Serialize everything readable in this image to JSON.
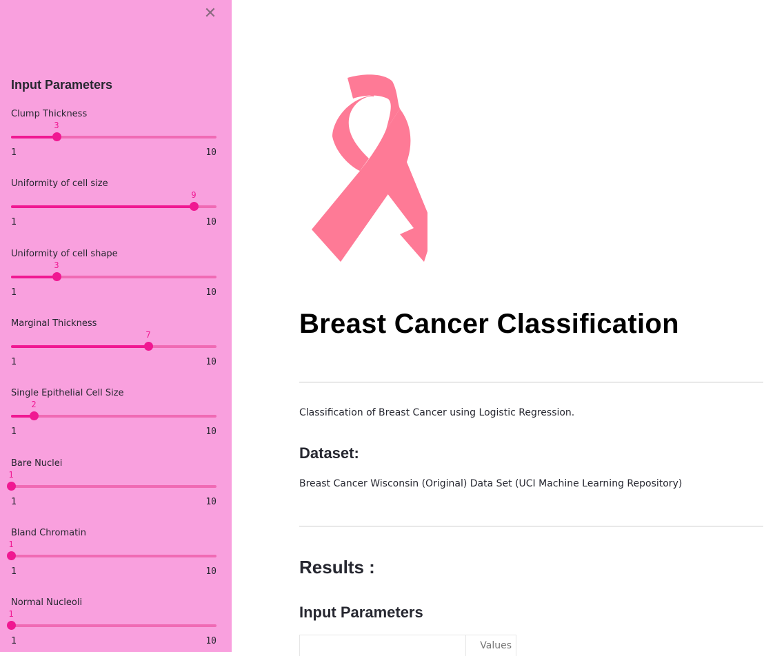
{
  "sidebar": {
    "close_icon": "close-icon",
    "heading": "Input Parameters",
    "sliders": [
      {
        "label": "Clump Thickness",
        "value": 3,
        "min": 1,
        "max": 10
      },
      {
        "label": "Uniformity of cell size",
        "value": 9,
        "min": 1,
        "max": 10
      },
      {
        "label": "Uniformity of cell shape",
        "value": 3,
        "min": 1,
        "max": 10
      },
      {
        "label": "Marginal Thickness",
        "value": 7,
        "min": 1,
        "max": 10
      },
      {
        "label": "Single Epithelial Cell Size",
        "value": 2,
        "min": 1,
        "max": 10
      },
      {
        "label": "Bare Nuclei",
        "value": 1,
        "min": 1,
        "max": 10
      },
      {
        "label": "Bland Chromatin",
        "value": 1,
        "min": 1,
        "max": 10
      },
      {
        "label": "Normal Nucleoli",
        "value": 1,
        "min": 1,
        "max": 10
      }
    ]
  },
  "main": {
    "logo_icon": "pink-ribbon-icon",
    "title": "Breast Cancer Classification",
    "description": "Classification of Breast Cancer using Logistic Regression.",
    "dataset_heading": "Dataset:",
    "dataset_text": "Breast Cancer Wisconsin (Original) Data Set (UCI Machine Learning Repository)",
    "results_heading": "Results :",
    "input_params_heading": "Input Parameters",
    "table_header_values": "Values"
  },
  "colors": {
    "sidebar_bg": "#f9a0de",
    "accent": "#f01892",
    "ribbon": "#fe7a96"
  }
}
